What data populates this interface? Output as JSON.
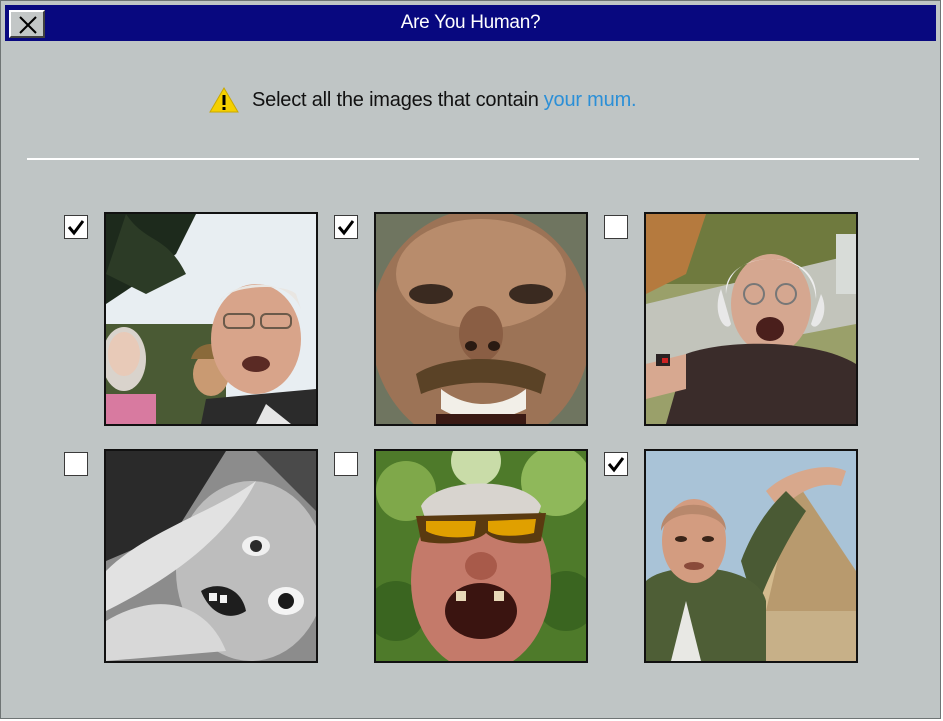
{
  "window": {
    "title": "Are You Human?",
    "close_icon": "close-x-icon"
  },
  "prompt": {
    "icon": "warning-triangle-icon",
    "text": "Select all the images that contain",
    "link_text": "your mum."
  },
  "colors": {
    "titlebar": "#08087f",
    "window_bg": "#bfc5c5",
    "link": "#2b8fd7",
    "warning": "#f5d000"
  },
  "images": [
    {
      "checked": true,
      "description_icon": "elderly-group-selfie-photo"
    },
    {
      "checked": true,
      "description_icon": "bald-man-closeup-photo"
    },
    {
      "checked": false,
      "description_icon": "white-haired-man-selfie-photo"
    },
    {
      "checked": false,
      "description_icon": "grayscale-upside-down-face-photo"
    },
    {
      "checked": false,
      "description_icon": "man-sunglasses-shouting-photo"
    },
    {
      "checked": true,
      "description_icon": "man-pyramid-pose-photo"
    }
  ]
}
